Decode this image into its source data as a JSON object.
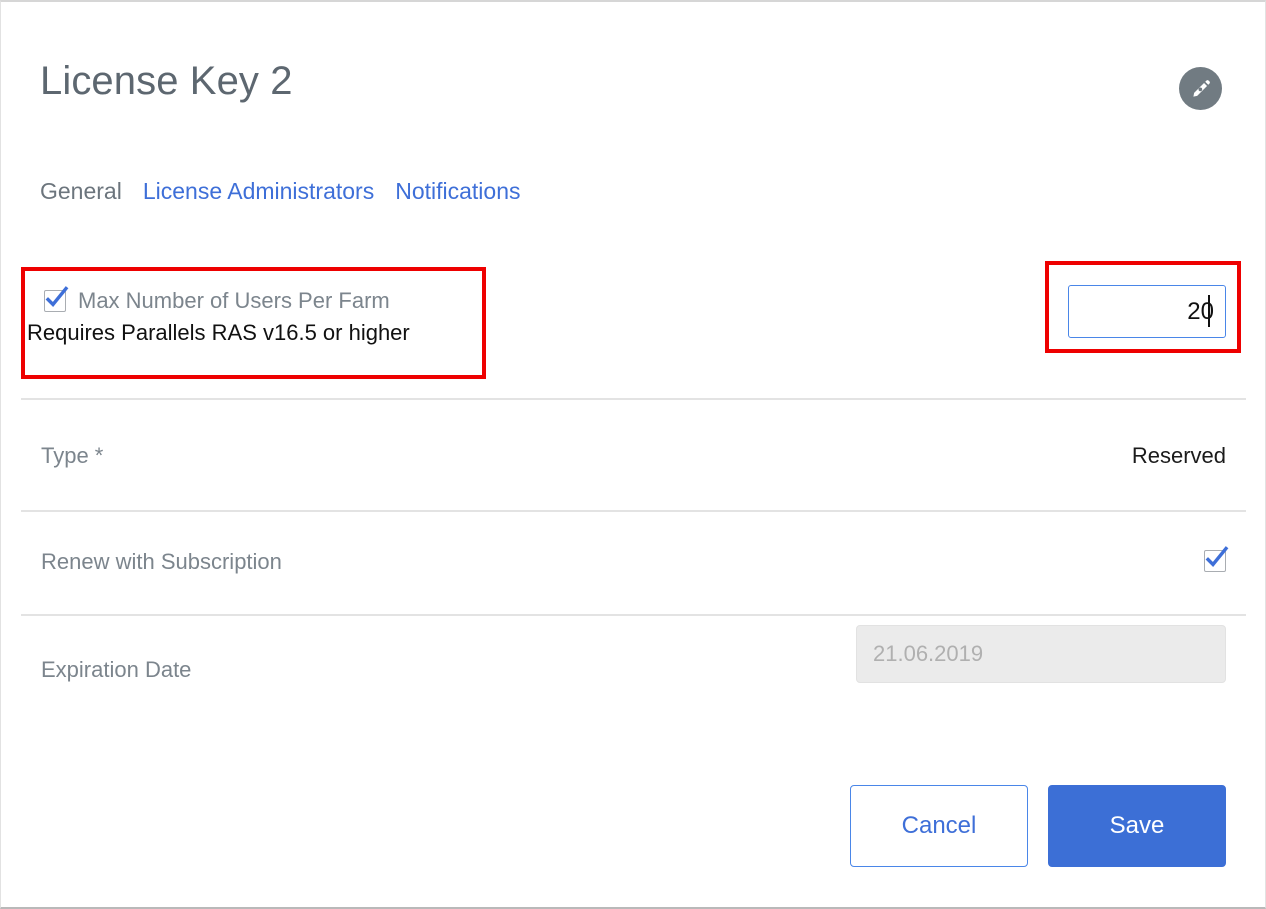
{
  "header": {
    "title": "License Key 2",
    "edit_icon": "pencil-icon"
  },
  "tabs": [
    {
      "label": "General",
      "active": true
    },
    {
      "label": "License Administrators",
      "active": false
    },
    {
      "label": "Notifications",
      "active": false
    }
  ],
  "form": {
    "max_users": {
      "label": "Max Number of Users Per Farm",
      "hint": "Requires Parallels RAS v16.5 or higher",
      "checked": true,
      "value": "20",
      "checkbox_icon": "checkmark-icon",
      "annotation_color": "#ee0000"
    },
    "type": {
      "label": "Type *",
      "value": "Reserved"
    },
    "renew": {
      "label": "Renew with Subscription",
      "checked": true,
      "checkbox_icon": "checkmark-icon"
    },
    "expiration": {
      "label": "Expiration Date",
      "value": "21.06.2019",
      "disabled": true
    }
  },
  "actions": {
    "cancel_label": "Cancel",
    "save_label": "Save"
  },
  "colors": {
    "accent_blue": "#3e6fd8",
    "save_blue": "#3c6fd6",
    "label_gray": "#7c858d",
    "annotation_red": "#ee0000",
    "edit_button_gray": "#717b82"
  }
}
